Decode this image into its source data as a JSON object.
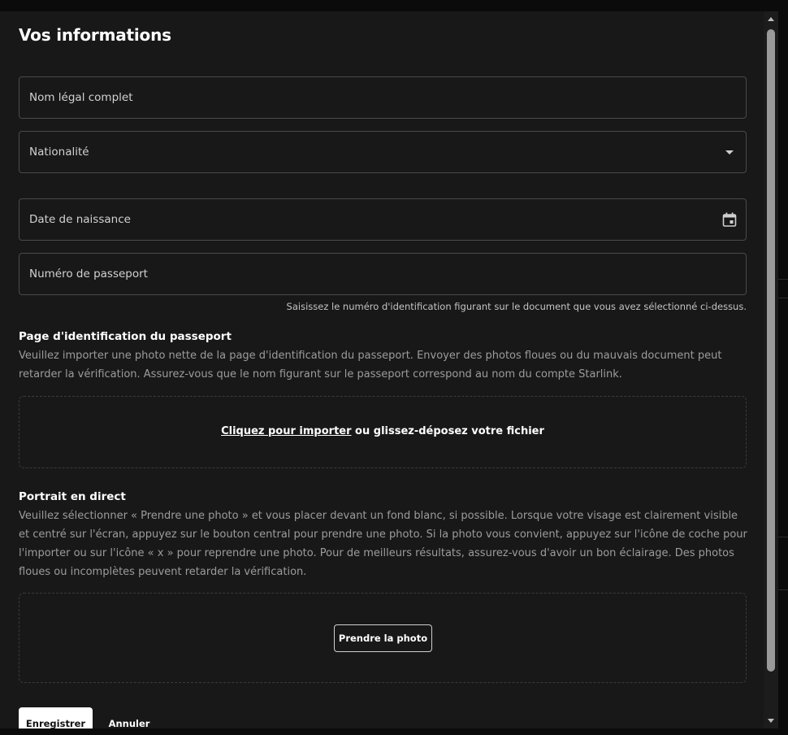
{
  "form": {
    "title": "Vos informations",
    "legal_name_placeholder": "Nom légal complet",
    "nationality_placeholder": "Nationalité",
    "birthdate_placeholder": "Date de naissance",
    "passport_number_placeholder": "Numéro de passeport",
    "passport_number_helper": "Saisissez le numéro d'identification figurant sur le document que vous avez sélectionné ci-dessus."
  },
  "passport_page": {
    "title": "Page d'identification du passeport",
    "description": "Veuillez importer une photo nette de la page d'identification du passeport. Envoyer des photos floues ou du mauvais document peut retarder la vérification. Assurez-vous que le nom figurant sur le passeport correspond au nom du compte Starlink.",
    "upload_link": "Cliquez pour importer",
    "upload_rest": " ou glissez-déposez votre fichier"
  },
  "portrait": {
    "title": "Portrait en direct",
    "description": "Veuillez sélectionner « Prendre une photo » et vous placer devant un fond blanc, si possible. Lorsque votre visage est clairement visible et centré sur l'écran, appuyez sur le bouton central pour prendre une photo. Si la photo vous convient, appuyez sur l'icône de coche pour l'importer ou sur l'icône « x » pour reprendre une photo. Pour de meilleurs résultats, assurez-vous d'avoir un bon éclairage. Des photos floues ou incomplètes peuvent retarder la vérification.",
    "take_photo_label": "Prendre la photo"
  },
  "actions": {
    "save_label": "Enregistrer",
    "cancel_label": "Annuler"
  },
  "icons": {
    "dropdown": "caret-down-icon",
    "calendar": "calendar-icon"
  },
  "colors": {
    "background": "#181818",
    "field_border": "#4a4a4a",
    "text_primary": "#ffffff",
    "text_muted": "#9c9c9c"
  }
}
